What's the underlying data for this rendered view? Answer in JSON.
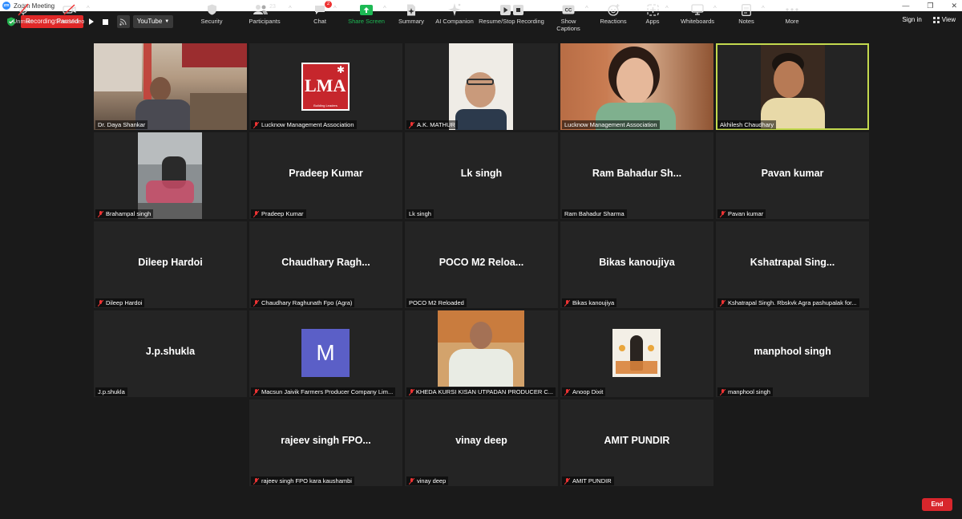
{
  "window": {
    "title": "Zoom Meeting"
  },
  "topbar": {
    "recording": "Recording Paused",
    "stream": "YouTube",
    "sign_in": "Sign in",
    "view": "View"
  },
  "tiles": [
    {
      "big": "",
      "label": "Dr. Daya Shankar",
      "muted": false
    },
    {
      "big": "",
      "label": "Lucknow Management Association",
      "muted": true
    },
    {
      "big": "",
      "label": "A.K. MATHUR",
      "muted": true
    },
    {
      "big": "",
      "label": "Lucknow Management Association",
      "muted": false
    },
    {
      "big": "",
      "label": "Akhilesh Chaudhary",
      "muted": false
    },
    {
      "big": "",
      "label": "Brahampal singh",
      "muted": true
    },
    {
      "big": "Pradeep Kumar",
      "label": "Pradeep Kumar",
      "muted": true
    },
    {
      "big": "Lk singh",
      "label": "Lk singh",
      "muted": false
    },
    {
      "big": "Ram Bahadur Sh...",
      "label": "Ram Bahadur Sharma",
      "muted": false
    },
    {
      "big": "Pavan kumar",
      "label": "Pavan kumar",
      "muted": true
    },
    {
      "big": "Dileep Hardoi",
      "label": "Dileep Hardoi",
      "muted": true
    },
    {
      "big": "Chaudhary  Ragh...",
      "label": "Chaudhary Raghunath Fpo (Agra)",
      "muted": true
    },
    {
      "big": "POCO M2 Reloa...",
      "label": "POCO M2 Reloaded",
      "muted": false
    },
    {
      "big": "Bikas kanoujiya",
      "label": "Bikas kanoujiya",
      "muted": true
    },
    {
      "big": "Kshatrapal  Sing...",
      "label": "Kshatrapal Singh. Rbskvk Agra pashupalak for...",
      "muted": true
    },
    {
      "big": "J.p.shukla",
      "label": "J.p.shukla",
      "muted": false
    },
    {
      "big": "",
      "label": "Macsun Jaivik Farmers Producer Company Lim...",
      "muted": true,
      "avatar": "M"
    },
    {
      "big": "",
      "label": "KHEDA KURSI KISAN UTPADAN PRODUCER C...",
      "muted": true
    },
    {
      "big": "",
      "label": "Anoop Dixit",
      "muted": true
    },
    {
      "big": "manphool singh",
      "label": "manphool singh",
      "muted": true
    },
    {
      "big": "rajeev singh FPO...",
      "label": "rajeev singh FPO kara kaushambi",
      "muted": true
    },
    {
      "big": "vinay deep",
      "label": "vinay deep",
      "muted": true
    },
    {
      "big": "AMIT PUNDIR",
      "label": "AMIT PUNDIR",
      "muted": true
    }
  ],
  "logo": {
    "text": "LMA",
    "subtext": "Building Leaders"
  },
  "toolbar": {
    "unmute": "Unmute",
    "start_video": "Start Video",
    "security": "Security",
    "participants": "Participants",
    "participants_count": "23",
    "chat": "Chat",
    "chat_badge": "2",
    "share_screen": "Share Screen",
    "summary": "Summary",
    "ai_companion": "AI Companion",
    "resume_stop_recording": "Resume/Stop Recording",
    "show_captions": "Show Captions",
    "reactions": "Reactions",
    "apps": "Apps",
    "whiteboards": "Whiteboards",
    "notes": "Notes",
    "more": "More",
    "end": "End"
  },
  "colors": {
    "accent": "#2d8cff",
    "recording": "#e02828",
    "end": "#d8262c",
    "active_speaker": "#c3d94e",
    "share_green": "#1db954",
    "avatar": "#5b5fc7"
  }
}
